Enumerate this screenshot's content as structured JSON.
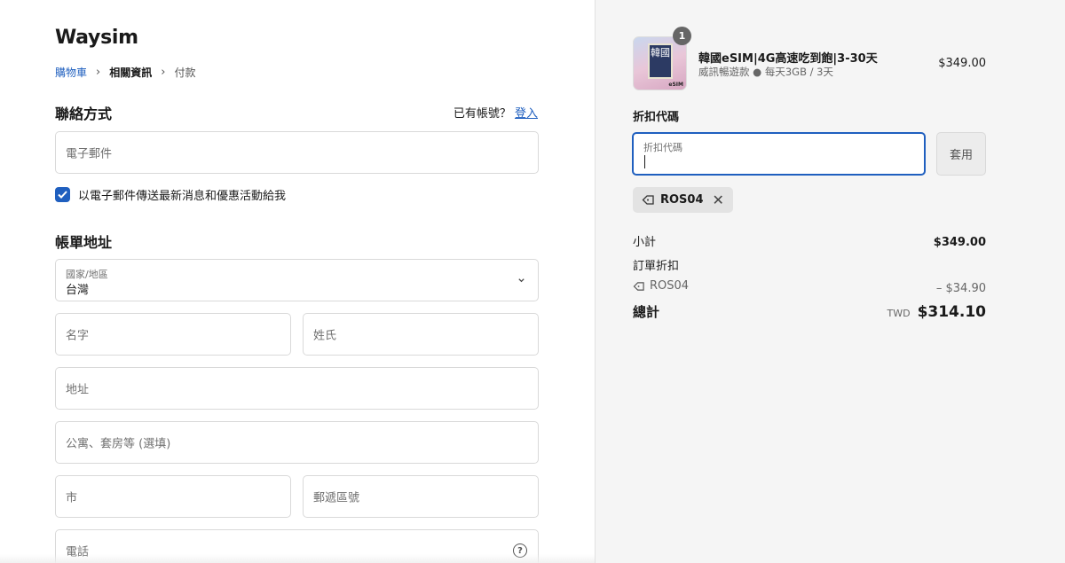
{
  "brand": "Waysim",
  "breadcrumb": {
    "cart": "購物車",
    "info": "相關資訊",
    "payment": "付款"
  },
  "contact": {
    "title": "聯絡方式",
    "have_account": "已有帳號？",
    "login": "登入",
    "email_placeholder": "電子郵件",
    "newsletter_label": "以電子郵件傳送最新消息和優惠活動給我",
    "newsletter_checked": true
  },
  "billing": {
    "title": "帳單地址",
    "country_label": "國家/地區",
    "country_value": "台灣",
    "first_name": "名字",
    "last_name": "姓氏",
    "address": "地址",
    "apartment": "公寓、套房等 (選填)",
    "city": "市",
    "postal": "郵遞區號",
    "phone": "電話"
  },
  "order": {
    "qty_badge": "1",
    "thumb_text": "韓國",
    "thumb_tag": "eSIM",
    "product_name": "韓國eSIM|4G高速吃到飽|3-30天",
    "product_variant": "威訊暢遊款 ● 每天3GB / 3天",
    "product_price": "$349.00",
    "discount_title": "折扣代碼",
    "discount_label": "折扣代碼",
    "apply_label": "套用",
    "applied_code": "ROS04",
    "subtotal_label": "小計",
    "subtotal_value": "$349.00",
    "order_discount_label": "訂單折扣",
    "discount_code": "ROS04",
    "discount_value": "– $34.90",
    "total_label": "總計",
    "currency": "TWD",
    "total_value": "$314.10"
  },
  "colors": {
    "accent": "#1f5fbf",
    "panel_bg": "#f5f5f5"
  }
}
